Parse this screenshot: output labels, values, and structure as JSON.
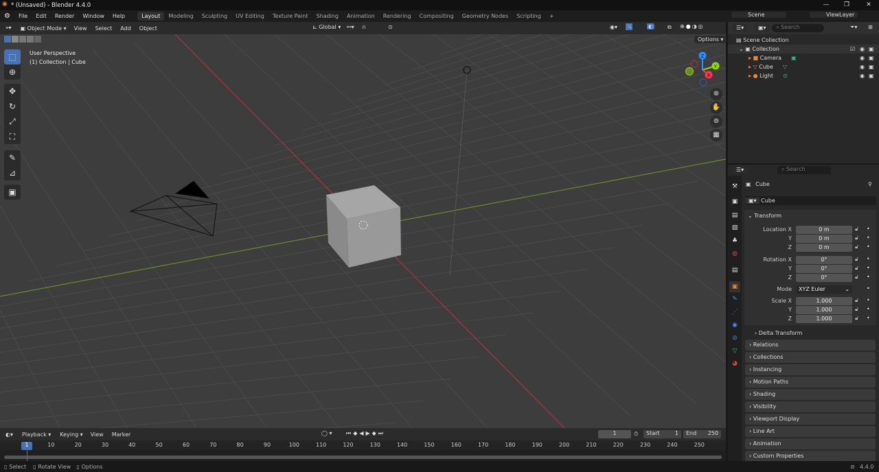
{
  "window": {
    "title": "* (Unsaved) - Blender 4.4.0"
  },
  "menu": [
    "File",
    "Edit",
    "Render",
    "Window",
    "Help"
  ],
  "workspaces": [
    "Layout",
    "Modeling",
    "Sculpting",
    "UV Editing",
    "Texture Paint",
    "Shading",
    "Animation",
    "Rendering",
    "Compositing",
    "Geometry Nodes",
    "Scripting"
  ],
  "active_workspace": "Layout",
  "scene": {
    "name": "Scene",
    "view_layer": "ViewLayer"
  },
  "viewport": {
    "mode": "Object Mode",
    "menus": [
      "View",
      "Select",
      "Add",
      "Object"
    ],
    "orientation": "Global",
    "options": "Options",
    "info_line1": "User Perspective",
    "info_line2": "(1) Collection | Cube",
    "gizmo": {
      "x": "X",
      "y": "Y",
      "z": "Z"
    }
  },
  "outliner": {
    "search_placeholder": "Search",
    "scene_collection": "Scene Collection",
    "collection": "Collection",
    "items": [
      "Camera",
      "Cube",
      "Light"
    ]
  },
  "properties": {
    "search_placeholder": "Search",
    "object": "Cube",
    "object_name": "Cube",
    "transform": "Transform",
    "location": {
      "label": "Location X",
      "x": "0 m",
      "y": "0 m",
      "z": "0 m"
    },
    "rotation": {
      "label": "Rotation X",
      "x": "0°",
      "y": "0°",
      "z": "0°"
    },
    "mode_label": "Mode",
    "mode": "XYZ Euler",
    "scale": {
      "label": "Scale X",
      "x": "1.000",
      "y": "1.000",
      "z": "1.000"
    },
    "axis_y": "Y",
    "axis_z": "Z",
    "delta": "Delta Transform",
    "panels": [
      "Relations",
      "Collections",
      "Instancing",
      "Motion Paths",
      "Shading",
      "Visibility",
      "Viewport Display",
      "Line Art",
      "Animation",
      "Custom Properties"
    ]
  },
  "timeline": {
    "menus": [
      "Playback",
      "Keying",
      "View",
      "Marker"
    ],
    "current_frame": "1",
    "start_label": "Start",
    "start": "1",
    "end_label": "End",
    "end": "250",
    "ticks": [
      10,
      20,
      30,
      40,
      50,
      60,
      70,
      80,
      90,
      100,
      110,
      120,
      130,
      140,
      150,
      160,
      170,
      180,
      190,
      200,
      210,
      220,
      230,
      240,
      250
    ],
    "playhead": "1"
  },
  "statusbar": {
    "select": "Select",
    "rotate": "Rotate View",
    "options": "Options",
    "version": "4.4.0"
  },
  "colors": {
    "accent": "#4772b3",
    "x_axis": "#ff3352",
    "y_axis": "#8bdc00",
    "z_axis": "#2890ff",
    "orange": "#e8882f",
    "green": "#3fb88c"
  }
}
